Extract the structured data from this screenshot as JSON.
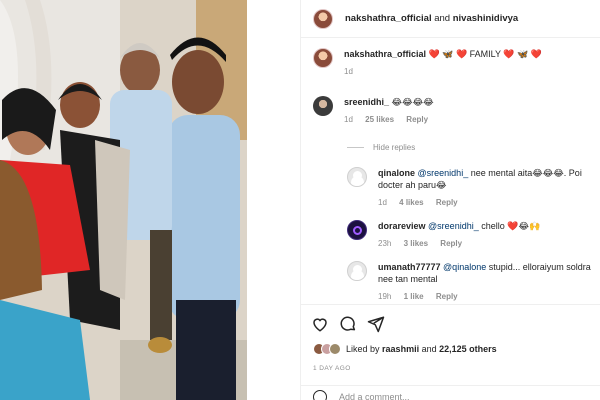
{
  "post": {
    "header": {
      "account": "nakshathra_official",
      "conjunction": "and",
      "collaborator": "nivashinidivya"
    },
    "caption": {
      "username": "nakshathra_official",
      "text": "❤️ 🦋 ❤️ FAMILY ❤️ 🦋 ❤️",
      "time": "1d"
    }
  },
  "comments": [
    {
      "username": "sreenidhi_",
      "text": "😂😂😂😂",
      "time": "1d",
      "likes": "25 likes",
      "reply": "Reply"
    }
  ],
  "hide_replies": "Hide replies",
  "replies": [
    {
      "username": "qinalone",
      "mention": "@sreenidhi_",
      "text": "nee mental aita😂😂😂. Poi docter ah paru😂",
      "time": "1d",
      "likes": "4 likes",
      "reply": "Reply"
    },
    {
      "username": "dorareview",
      "mention": "@sreenidhi_",
      "text": "chello ❤️😂🙌",
      "time": "23h",
      "likes": "3 likes",
      "reply": "Reply"
    },
    {
      "username": "umanath77777",
      "mention": "@qinalone",
      "text": "stupid... elloraiyum soldra nee tan mental",
      "time": "19h",
      "likes": "1 like",
      "reply": "Reply"
    }
  ],
  "actions": {
    "liked_by_prefix": "Liked by",
    "liked_by_user": "raashmii",
    "liked_by_joiner": "and",
    "others": "22,125 others",
    "time_ago": "1 DAY AGO",
    "add_comment_placeholder": "Add a comment..."
  },
  "colors": {
    "text": "#262626",
    "muted": "#8e8e8e",
    "mention": "#00376b",
    "heart": "#e0245e",
    "border": "#efefef"
  },
  "icons": [
    "heart-icon",
    "comment-icon",
    "share-icon",
    "emoji-icon"
  ]
}
